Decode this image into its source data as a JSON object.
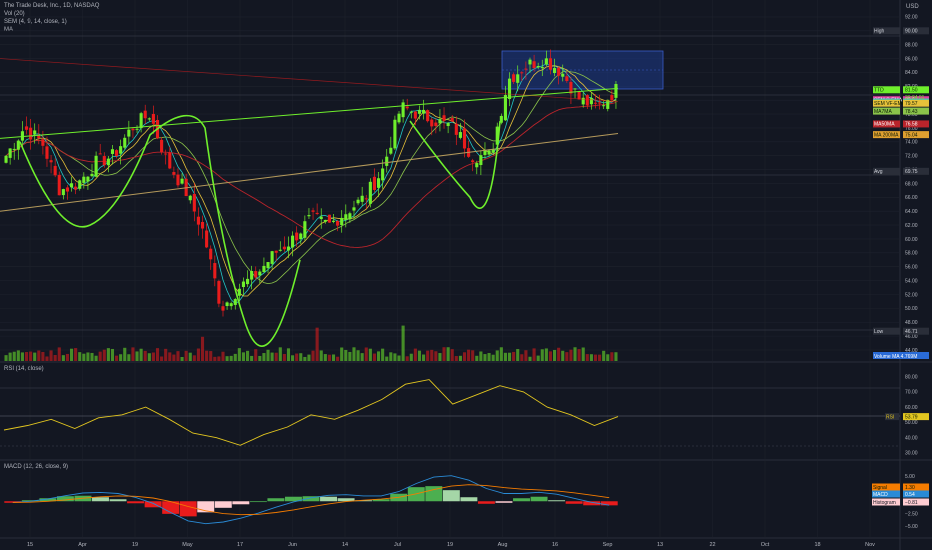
{
  "header": {
    "symbol_line": "The Trade Desk, Inc., 1D, NASDAQ",
    "vol_line": "Vol (20)",
    "sem_line": "SEM (4, 9, 14, close, 1)",
    "ma_line": "MA",
    "currency": "USD"
  },
  "rsi_pane": {
    "label": "RSI (14, close)"
  },
  "macd_pane": {
    "label": "MACD (12, 26, close, 9)"
  },
  "price_tags": {
    "high": {
      "label": "High",
      "value": "90.00"
    },
    "ttd": {
      "label": "TTD",
      "value": "81.50",
      "countdown": "20:04:01"
    },
    "sem_s": {
      "label": "SEM S-EMA",
      "value": "80.07"
    },
    "sem_e": {
      "label": "SEM E-EMA",
      "value": "79.73"
    },
    "sem_vf": {
      "label": "SEM VF-EMA",
      "value": "79.57"
    },
    "ma7": {
      "label": "MA7MA",
      "value": "78.43"
    },
    "ma50": {
      "label": "MA50MA",
      "value": "76.58"
    },
    "ma200": {
      "label": "MA 200MA",
      "value": "75.04"
    },
    "avg": {
      "label": "Avg",
      "value": "69.75"
    },
    "low": {
      "label": "Low",
      "value": "46.71"
    },
    "volume_ma": {
      "label": "Volume MA",
      "value": "4.769M"
    },
    "rsi": {
      "label": "RSI",
      "value": "53.79"
    },
    "signal": {
      "label": "Signal",
      "value": "1.30"
    },
    "macd": {
      "label": "MACD",
      "value": "0.54"
    },
    "histogram": {
      "label": "Histogram",
      "value": "−0.81"
    }
  },
  "axis": {
    "price_ticks": [
      "92.00",
      "90.00",
      "88.00",
      "86.00",
      "84.00",
      "82.00",
      "80.00",
      "78.00",
      "76.00",
      "74.00",
      "72.00",
      "70.00",
      "68.00",
      "66.00",
      "64.00",
      "62.00",
      "60.00",
      "58.00",
      "56.00",
      "54.00",
      "52.00",
      "50.00",
      "48.00",
      "46.00",
      "44.00"
    ],
    "rsi_ticks": [
      "80.00",
      "70.00",
      "60.00",
      "50.00",
      "40.00",
      "30.00"
    ],
    "macd_ticks": [
      "5.00",
      "2.50",
      "0.00",
      "−2.50",
      "−5.00"
    ],
    "date_ticks": [
      "15",
      "Apr",
      "19",
      "May",
      "17",
      "Jun",
      "14",
      "Jul",
      "19",
      "Aug",
      "16",
      "Sep",
      "13",
      "22",
      "Oct",
      "18",
      "Nov"
    ]
  },
  "colors": {
    "background": "#131722",
    "up": "#6fef2c",
    "down": "#e91c1c",
    "trendline": "#6fef2c",
    "ma200": "#b59a5b",
    "ma50": "#b9242b",
    "rsi": "#e2c620",
    "macd": "#2a8bd6",
    "signal": "#f57c00",
    "box": "#1e3a8a"
  },
  "chart_data": {
    "type": "candlestick",
    "title": "The Trade Desk, Inc., 1D, NASDAQ",
    "x": [
      "15",
      "Apr",
      "19",
      "May",
      "17",
      "Jun",
      "14",
      "Jul",
      "19",
      "Aug",
      "16"
    ],
    "close_path": [
      72,
      76,
      74,
      67,
      68,
      71,
      72,
      76,
      78,
      71,
      67,
      61,
      50,
      53,
      55,
      58,
      60,
      63,
      62,
      64,
      66,
      70,
      79,
      78,
      77,
      76,
      72,
      72,
      83,
      85,
      86,
      84,
      80,
      79,
      81.5
    ],
    "ylim": [
      44,
      93
    ],
    "high": 90.0,
    "low": 46.71,
    "last": 81.5,
    "rsi_series": [
      45,
      48,
      52,
      46,
      53,
      55,
      60,
      52,
      43,
      40,
      35,
      42,
      47,
      55,
      52,
      58,
      65,
      75,
      78,
      62,
      68,
      74,
      70,
      60,
      55,
      48,
      53.79
    ],
    "rsi_ylim": [
      28,
      83
    ],
    "macd_hist": [
      -0.3,
      0.2,
      0.6,
      1.0,
      1.1,
      0.8,
      0.4,
      -0.4,
      -1.2,
      -2.5,
      -3.0,
      -2.2,
      -1.3,
      -0.6,
      0.0,
      0.6,
      0.9,
      1.0,
      0.9,
      0.6,
      0.2,
      0.4,
      1.5,
      2.8,
      3.0,
      2.2,
      0.8,
      -0.5,
      -0.3,
      0.6,
      0.9,
      0.2,
      -0.5,
      -0.8,
      -0.81
    ],
    "macd_ylim": [
      -6.5,
      7
    ]
  }
}
